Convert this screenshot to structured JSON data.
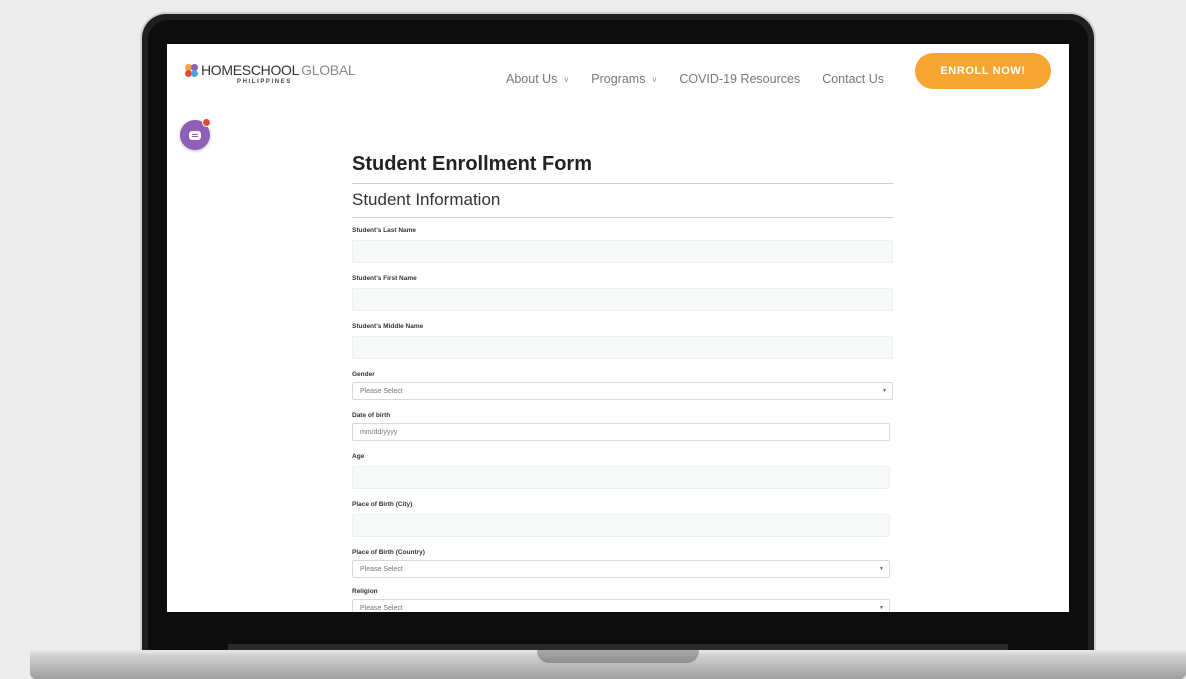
{
  "header": {
    "logo": {
      "name_strong": "HOMESCHOOL",
      "name_light": "GLOBAL",
      "subtitle": "PHILIPPINES"
    },
    "nav": [
      {
        "label": "About Us",
        "has_dropdown": true
      },
      {
        "label": "Programs",
        "has_dropdown": true
      },
      {
        "label": "COVID-19 Resources",
        "has_dropdown": false
      },
      {
        "label": "Contact Us",
        "has_dropdown": false
      }
    ],
    "cta_label": "ENROLL NOW!",
    "cta_color": "#f6a531"
  },
  "chat": {
    "icon": "chat-icon",
    "color": "#8e5fb5",
    "badge_color": "#e04b3a"
  },
  "form": {
    "title": "Student Enrollment Form",
    "section": "Student Information",
    "fields": {
      "last_name": {
        "label": "Student's Last Name",
        "value": ""
      },
      "first_name": {
        "label": "Student's First Name",
        "value": ""
      },
      "middle_name": {
        "label": "Student's Middle Name",
        "value": ""
      },
      "gender": {
        "label": "Gender",
        "selected": "Please Select"
      },
      "dob": {
        "label": "Date of birth",
        "placeholder": "mm/dd/yyyy"
      },
      "age": {
        "label": "Age",
        "value": ""
      },
      "birth_city": {
        "label": "Place of Birth (City)",
        "value": ""
      },
      "birth_country": {
        "label": "Place of Birth (Country)",
        "selected": "Please Select"
      },
      "religion": {
        "label": "Religion",
        "selected": "Please Select"
      }
    }
  }
}
